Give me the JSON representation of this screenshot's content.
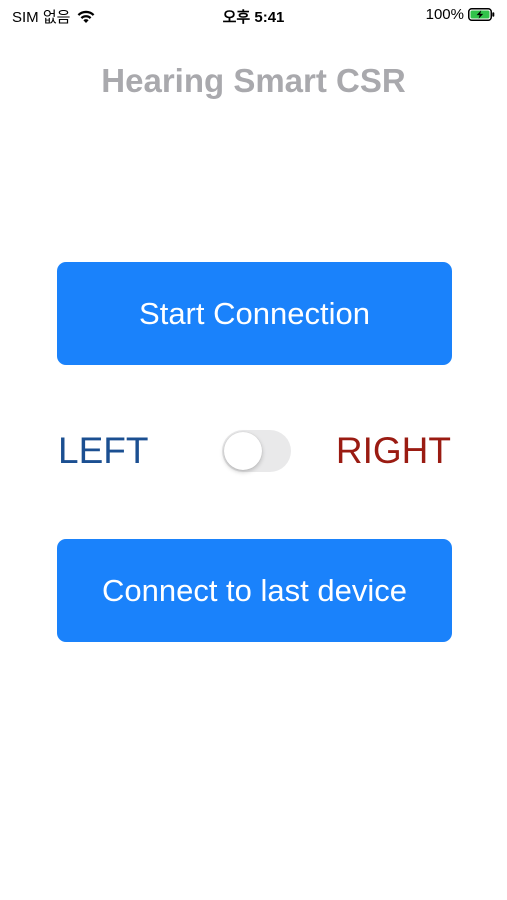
{
  "status_bar": {
    "carrier": "SIM 없음",
    "time": "오후 5:41",
    "battery_percent": "100%",
    "battery_level": 1.0,
    "battery_color": "#30c24a"
  },
  "app": {
    "title": "Hearing Smart CSR"
  },
  "buttons": {
    "start_connection": "Start Connection",
    "connect_last": "Connect to last device",
    "accent_color": "#1a82fb"
  },
  "side_selector": {
    "left_label": "LEFT",
    "right_label": "RIGHT",
    "toggle_on": false
  }
}
